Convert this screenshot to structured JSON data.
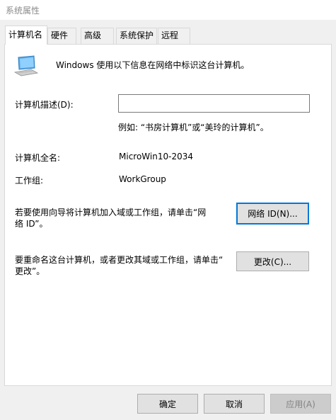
{
  "window": {
    "title": "系统属性"
  },
  "tabs": [
    {
      "label": "计算机名",
      "active": true
    },
    {
      "label": "硬件",
      "active": false
    },
    {
      "label": "高级",
      "active": false
    },
    {
      "label": "系统保护",
      "active": false
    },
    {
      "label": "远程",
      "active": false
    }
  ],
  "panel": {
    "intro_text": "Windows 使用以下信息在网络中标识这台计算机。",
    "description_label": "计算机描述(D):",
    "description_value": "",
    "description_example": "例如: “书房计算机”或“美玲的计算机”。",
    "fullname_label": "计算机全名:",
    "fullname_value": "MicroWin10-2034",
    "workgroup_label": "工作组:",
    "workgroup_value": "WorkGroup",
    "network_id_text_line1": "若要使用向导将计算机加入域或工作组，请单击“网",
    "network_id_text_line2": "络 ID”。",
    "network_id_button": "网络 ID(N)...",
    "rename_text_line1": "要重命名这台计算机，或者更改其域或工作组，请单击“",
    "rename_text_line2": "更改”。",
    "change_button": "更改(C)..."
  },
  "footer": {
    "ok_button": "确定",
    "cancel_button": "取消",
    "apply_button": "应用(A)"
  },
  "colors": {
    "accent": "#0078d7",
    "window_bg": "#f0f0f0",
    "panel_bg": "#ffffff",
    "button_bg": "#e1e1e1",
    "button_border": "#adadad",
    "disabled_text": "#838383",
    "icon_name": "computer-icon"
  }
}
